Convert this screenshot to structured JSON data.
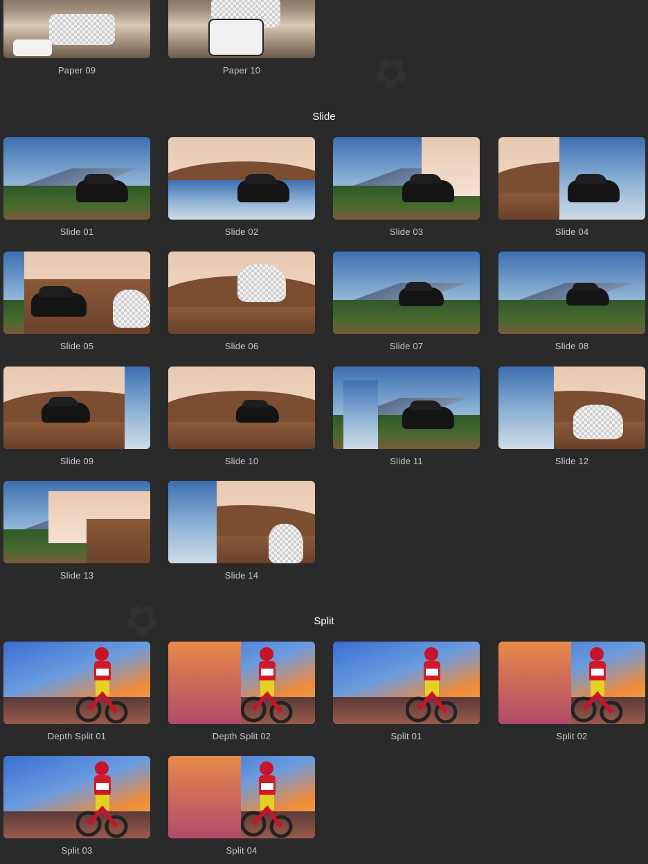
{
  "sections": [
    {
      "id": "paper",
      "title": "",
      "items": [
        "Paper 09",
        "Paper 10"
      ]
    },
    {
      "id": "slide",
      "title": "Slide",
      "items": [
        "Slide 01",
        "Slide 02",
        "Slide 03",
        "Slide 04",
        "Slide 05",
        "Slide 06",
        "Slide 07",
        "Slide 08",
        "Slide 09",
        "Slide 10",
        "Slide 11",
        "Slide 12",
        "Slide 13",
        "Slide 14"
      ]
    },
    {
      "id": "split",
      "title": "Split",
      "items": [
        "Depth Split 01",
        "Depth Split 02",
        "Split 01",
        "Split 02",
        "Split 03",
        "Split 04"
      ]
    }
  ],
  "headers": {
    "slide": "Slide",
    "split": "Split"
  },
  "colors": {
    "background": "#2a2a2b",
    "label": "#c8c8c8",
    "header": "#ffffff"
  }
}
